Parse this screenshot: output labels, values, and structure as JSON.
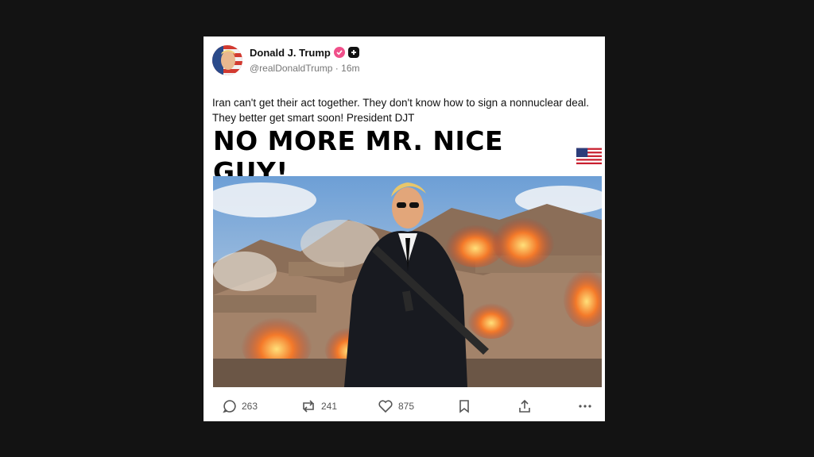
{
  "post": {
    "author_name": "Donald J. Trump",
    "handle": "@realDonaldTrump",
    "separator": "·",
    "time_ago": "16m",
    "text": "Iran can't get their act together. They don't know how to sign a nonnuclear deal. They better get smart soon! President DJT",
    "image_headline": "NO MORE MR. NICE GUY!",
    "flag_icon": "us-flag-icon"
  },
  "actions": {
    "replies": "263",
    "reposts": "241",
    "likes": "875"
  },
  "colors": {
    "verified_badge": "#f0508a",
    "page_background": "#131313"
  }
}
